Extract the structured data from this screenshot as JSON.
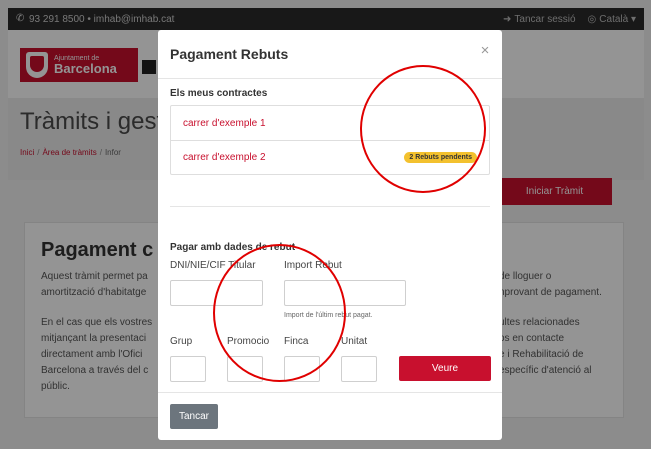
{
  "topbar": {
    "contact": "93 291 8500 • imhab@imhab.cat",
    "logout": "Tancar sessió",
    "language": "Català",
    "phone_icon": "phone-icon",
    "logout_icon": "logout-icon",
    "globe_icon": "globe-icon"
  },
  "logo": {
    "line1": "Ajuntament de",
    "line2": "Barcelona"
  },
  "page": {
    "title": "Tràmits i gestio",
    "breadcrumb": {
      "home": "Inici",
      "area": "Àrea de tràmits",
      "current": "Infor"
    },
    "start_button": "Iniciar Tràmit"
  },
  "card": {
    "title": "Pagament c",
    "p1_line1": "Aquest tràmit permet pa",
    "p1_line2": "amortització d'habitatge",
    "p2_line1": "En el cas que els vostres",
    "p2_line2": "mitjançant la presentaci",
    "p2_line3": "directament amb l'Ofici",
    "p2_line4": "Barcelona a través del c",
    "p2_line5": "públic.",
    "r1_line1": "de lloguer o",
    "r1_line2": "nprovant de pagament.",
    "r2_line1": "ultes relacionades",
    "r2_line2": "os en contacte",
    "r2_line3": "e i Rehabilitació de",
    "r2_line4": "específic d'atenció al"
  },
  "modal": {
    "title": "Pagament Rebuts",
    "close": "×",
    "contracts_title": "Els meus contractes",
    "contracts": [
      {
        "label": "carrer d'exemple 1",
        "badge": ""
      },
      {
        "label": "carrer d'exemple 2",
        "badge": "2 Rebuts pendents"
      }
    ],
    "receipt_title": "Pagar amb dades de rebut",
    "fields": {
      "dni_label": "DNI/NIE/CIF Titular",
      "import_label": "Import Rebut",
      "import_hint": "Import de l'últim rebut pagat.",
      "grup_label": "Grup",
      "promocio_label": "Promocio",
      "finca_label": "Finca",
      "unitat_label": "Unitat"
    },
    "view_button": "Veure",
    "close_button": "Tancar"
  },
  "colors": {
    "brand": "#c8102e",
    "badge": "#f3c12e",
    "annotation": "#e00000"
  }
}
